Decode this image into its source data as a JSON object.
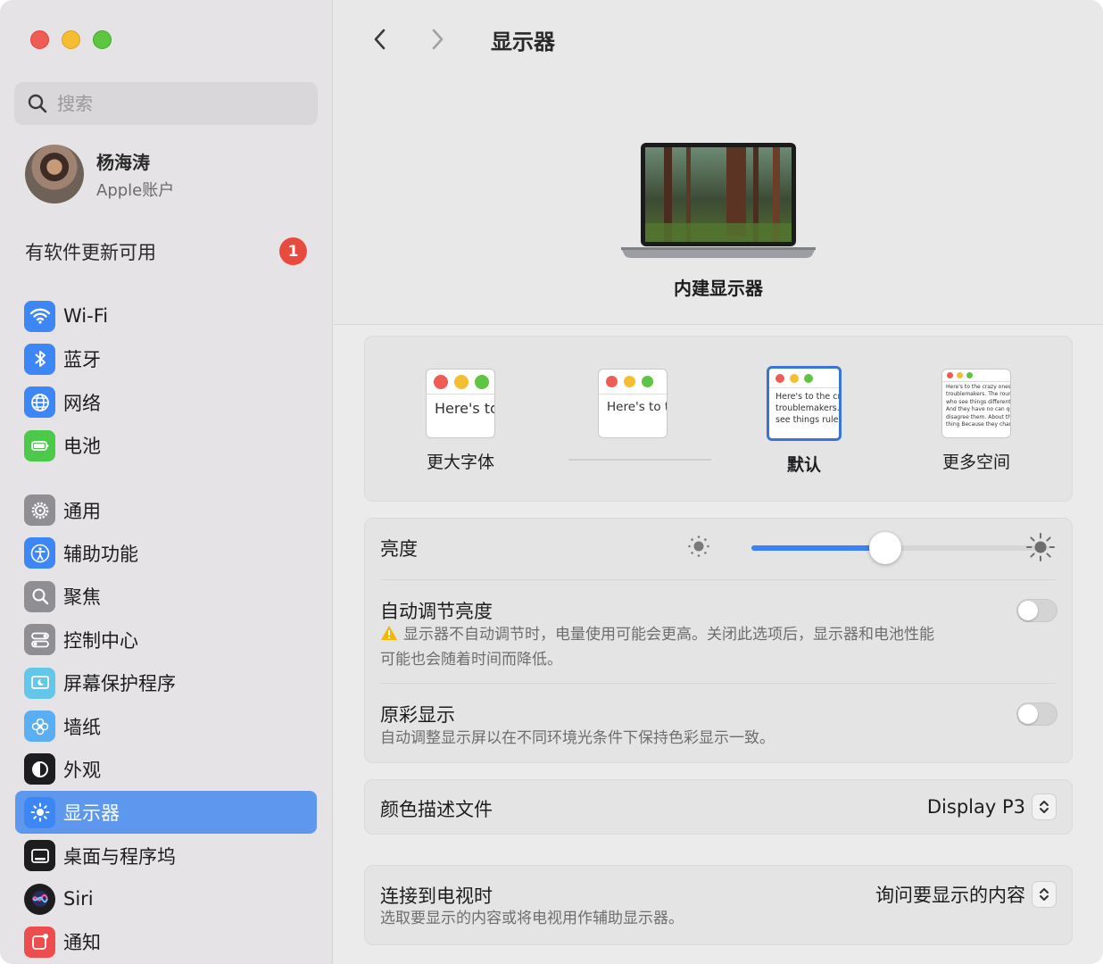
{
  "window": {
    "title": "显示器"
  },
  "colors": {
    "accent": "#3b82f6",
    "sidebar_active": "#5e97ee",
    "badge": "#e84a3e",
    "warning": "#f5b700"
  },
  "search": {
    "placeholder": "搜索",
    "value": ""
  },
  "account": {
    "name": "杨海涛",
    "subtitle": "Apple账户"
  },
  "software_update": {
    "label": "有软件更新可用",
    "badge": "1"
  },
  "sidebar": {
    "items": [
      {
        "label": "Wi-Fi",
        "icon": "wifi-icon"
      },
      {
        "label": "蓝牙",
        "icon": "bluetooth-icon"
      },
      {
        "label": "网络",
        "icon": "globe-icon"
      },
      {
        "label": "电池",
        "icon": "battery-icon"
      },
      {
        "label": "通用",
        "icon": "gear-icon"
      },
      {
        "label": "辅助功能",
        "icon": "accessibility-icon"
      },
      {
        "label": "聚焦",
        "icon": "spotlight-icon"
      },
      {
        "label": "控制中心",
        "icon": "control-center-icon"
      },
      {
        "label": "屏幕保护程序",
        "icon": "screensaver-icon"
      },
      {
        "label": "墙纸",
        "icon": "wallpaper-icon"
      },
      {
        "label": "外观",
        "icon": "appearance-icon"
      },
      {
        "label": "显示器",
        "icon": "display-icon",
        "selected": true
      },
      {
        "label": "桌面与程序坞",
        "icon": "dock-icon"
      },
      {
        "label": "Siri",
        "icon": "siri-icon"
      },
      {
        "label": "通知",
        "icon": "notifications-icon"
      }
    ]
  },
  "toolbar": {
    "back": "‹",
    "forward": "›"
  },
  "display": {
    "name": "内建显示器"
  },
  "resolution": {
    "options": [
      {
        "label": "更大字体",
        "preview": "Here's to the crazy troublemakers ones who"
      },
      {
        "label": "",
        "preview": "Here's to the troublemakers ones who"
      },
      {
        "label": "默认",
        "preview": "Here's to the crazy troublemakers. ones who see things rules. And they"
      },
      {
        "label": "更多空间",
        "preview": "Here's to the crazy ones troublemakers. The round ones who see things differently rules. And they have no can quote them, disagree them. About the only thing Because they change things"
      }
    ],
    "selected_index": 2
  },
  "brightness": {
    "label": "亮度",
    "value": 0.45
  },
  "auto_brightness": {
    "label": "自动调节亮度",
    "warning": "显示器不自动调节时，电量使用可能会更高。关闭此选项后，显示器和电池性能",
    "warning_cont": "可能也会随着时间而降低。",
    "enabled": false
  },
  "true_tone": {
    "label": "原彩显示",
    "description": "自动调整显示屏以在不同环境光条件下保持色彩显示一致。",
    "enabled": false
  },
  "color_profile": {
    "label": "颜色描述文件",
    "value": "Display P3"
  },
  "tv_connection": {
    "label": "连接到电视时",
    "description": "选取要显示的内容或将电视用作辅助显示器。",
    "value": "询问要显示的内容"
  }
}
